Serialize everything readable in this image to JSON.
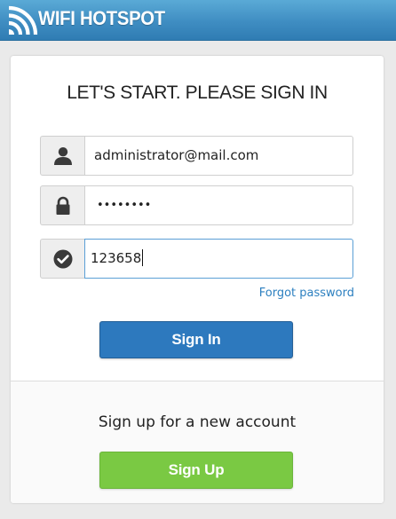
{
  "header": {
    "logo_icon": "wifi-signal-icon",
    "title": "WIFI HOTSPOT",
    "color": "#3f8dc2"
  },
  "login": {
    "heading": "LET'S START. PLEASE SIGN IN",
    "email": {
      "icon": "user-icon",
      "value": "administrator@mail.com"
    },
    "password": {
      "icon": "lock-icon",
      "masked_value": "••••••••"
    },
    "code": {
      "icon": "check-circle-icon",
      "value": "123658"
    },
    "forgot_label": "Forgot password",
    "signin_label": "Sign In",
    "signin_color": "#2d79be"
  },
  "signup": {
    "prompt": "Sign up for a new account",
    "button_label": "Sign Up",
    "button_color": "#7ac943"
  }
}
